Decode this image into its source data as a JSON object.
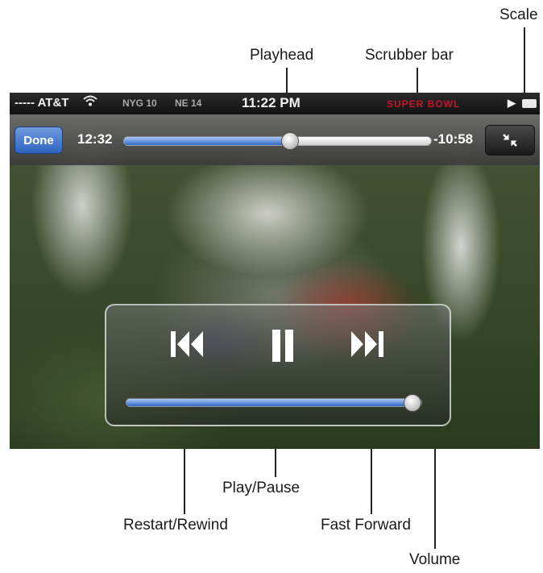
{
  "callouts": {
    "scale": "Scale",
    "playhead": "Playhead",
    "scrubber_bar": "Scrubber bar",
    "play_pause": "Play/Pause",
    "restart_rewind": "Restart/Rewind",
    "fast_forward": "Fast Forward",
    "volume": "Volume"
  },
  "status_bar": {
    "carrier": "----- AT&T",
    "score_left": "NYG 10",
    "score_right": "NE 14",
    "time": "11:22 PM",
    "brand": "SUPER BOWL",
    "icons": [
      "wifi-icon",
      "play-indicator-icon",
      "battery-icon"
    ]
  },
  "player": {
    "done_label": "Done",
    "elapsed": "12:32",
    "remaining": "-10:58",
    "progress": 0.54,
    "volume": 0.97,
    "state": "playing"
  },
  "icons": {
    "scale": "scale-icon",
    "rewind": "rewind-icon",
    "pause": "pause-icon",
    "fast_forward": "fast-forward-icon"
  },
  "colors": {
    "done_button": "#2f63c0",
    "progress_fill": "#2f68c8",
    "status_brand": "#c7152a"
  }
}
